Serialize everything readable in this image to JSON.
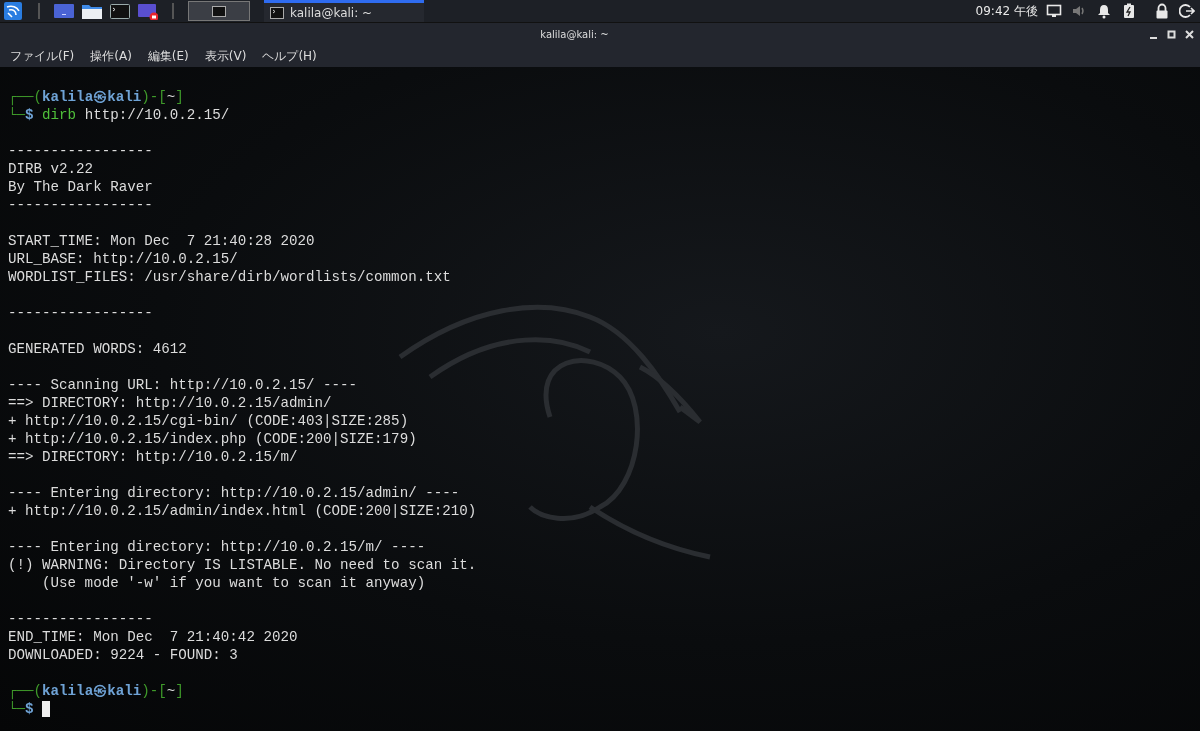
{
  "panel": {
    "launchers": [
      {
        "kind": "kali"
      },
      {
        "kind": "desktop"
      },
      {
        "kind": "files"
      },
      {
        "kind": "terminal"
      },
      {
        "kind": "recorder"
      }
    ],
    "workspace": {
      "selected": true
    },
    "tasks": [
      {
        "title": "kalila@kali: ~",
        "selected": true
      }
    ],
    "clock": "09:42 午後",
    "tray": [
      {
        "kind": "display"
      },
      {
        "kind": "volume",
        "muted": true
      },
      {
        "kind": "bell"
      },
      {
        "kind": "battery"
      },
      {
        "kind": "lock"
      },
      {
        "kind": "logout"
      }
    ]
  },
  "window": {
    "title": "kalila@kali: ~"
  },
  "menu": [
    "ファイル(F)",
    "操作(A)",
    "編集(E)",
    "表示(V)",
    "ヘルプ(H)"
  ],
  "terminal": {
    "lines": [
      {
        "kind": "blank"
      },
      {
        "kind": "prompt",
        "open": "┌──(",
        "user": "kalila㉿kali",
        "mid": ")-[",
        "dir": "~",
        "close": "]"
      },
      {
        "kind": "command",
        "corner": "└─",
        "symbol": "$",
        "program": "dirb",
        "args": "http://10.0.2.15/"
      },
      {
        "kind": "blank"
      },
      {
        "kind": "output",
        "text": "-----------------"
      },
      {
        "kind": "output",
        "text": "DIRB v2.22"
      },
      {
        "kind": "output",
        "text": "By The Dark Raver"
      },
      {
        "kind": "output",
        "text": "-----------------"
      },
      {
        "kind": "blank"
      },
      {
        "kind": "output",
        "text": "START_TIME: Mon Dec  7 21:40:28 2020"
      },
      {
        "kind": "output",
        "text": "URL_BASE: http://10.0.2.15/"
      },
      {
        "kind": "output",
        "text": "WORDLIST_FILES: /usr/share/dirb/wordlists/common.txt"
      },
      {
        "kind": "blank"
      },
      {
        "kind": "output",
        "text": "-----------------"
      },
      {
        "kind": "blank"
      },
      {
        "kind": "output",
        "text": "GENERATED WORDS: 4612"
      },
      {
        "kind": "blank"
      },
      {
        "kind": "output",
        "text": "---- Scanning URL: http://10.0.2.15/ ----"
      },
      {
        "kind": "output",
        "text": "==> DIRECTORY: http://10.0.2.15/admin/"
      },
      {
        "kind": "output",
        "text": "+ http://10.0.2.15/cgi-bin/ (CODE:403|SIZE:285)"
      },
      {
        "kind": "output",
        "text": "+ http://10.0.2.15/index.php (CODE:200|SIZE:179)"
      },
      {
        "kind": "output",
        "text": "==> DIRECTORY: http://10.0.2.15/m/"
      },
      {
        "kind": "blank"
      },
      {
        "kind": "output",
        "text": "---- Entering directory: http://10.0.2.15/admin/ ----"
      },
      {
        "kind": "output",
        "text": "+ http://10.0.2.15/admin/index.html (CODE:200|SIZE:210)"
      },
      {
        "kind": "blank"
      },
      {
        "kind": "output",
        "text": "---- Entering directory: http://10.0.2.15/m/ ----"
      },
      {
        "kind": "output",
        "text": "(!) WARNING: Directory IS LISTABLE. No need to scan it."
      },
      {
        "kind": "output",
        "text": "    (Use mode '-w' if you want to scan it anyway)"
      },
      {
        "kind": "blank"
      },
      {
        "kind": "output",
        "text": "-----------------"
      },
      {
        "kind": "output",
        "text": "END_TIME: Mon Dec  7 21:40:42 2020"
      },
      {
        "kind": "output",
        "text": "DOWNLOADED: 9224 - FOUND: 3"
      },
      {
        "kind": "blank"
      },
      {
        "kind": "prompt",
        "open": "┌──(",
        "user": "kalila㉿kali",
        "mid": ")-[",
        "dir": "~",
        "close": "]"
      },
      {
        "kind": "command",
        "corner": "└─",
        "symbol": "$",
        "cursor": true
      }
    ]
  }
}
